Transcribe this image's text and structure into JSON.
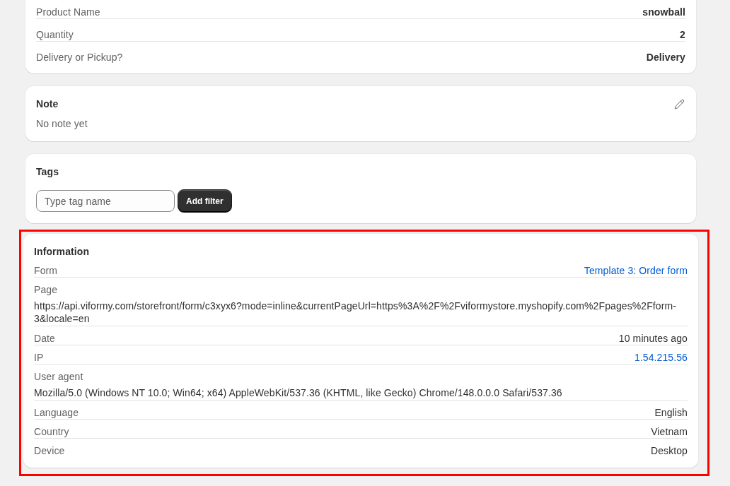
{
  "order_details": {
    "rows": [
      {
        "label": "Product Name",
        "value": "snowball"
      },
      {
        "label": "Quantity",
        "value": "2"
      },
      {
        "label": "Delivery or Pickup?",
        "value": "Delivery"
      }
    ]
  },
  "note": {
    "title": "Note",
    "text": "No note yet"
  },
  "tags": {
    "title": "Tags",
    "input": {
      "placeholder": "Type tag name"
    },
    "button": "Add filter"
  },
  "information": {
    "title": "Information",
    "highlighted": true,
    "rows": [
      {
        "kind": "inline",
        "label": "Form",
        "value": "Template 3: Order form",
        "link": true
      },
      {
        "kind": "stacked",
        "label": "Page",
        "value": "https://api.viformy.com/storefront/form/c3xyx6?mode=inline&currentPageUrl=https%3A%2F%2Fviformystore.myshopify.com%2Fpages%2Fform-3&locale=en",
        "link": false
      },
      {
        "kind": "inline",
        "label": "Date",
        "value": "10 minutes ago",
        "link": false
      },
      {
        "kind": "inline",
        "label": "IP",
        "value": "1.54.215.56",
        "link": true
      },
      {
        "kind": "stacked",
        "label": "User agent",
        "value": "Mozilla/5.0 (Windows NT 10.0; Win64; x64) AppleWebKit/537.36 (KHTML, like Gecko) Chrome/148.0.0.0 Safari/537.36",
        "link": false
      },
      {
        "kind": "inline",
        "label": "Language",
        "value": "English",
        "link": false
      },
      {
        "kind": "inline",
        "label": "Country",
        "value": "Vietnam",
        "link": false
      },
      {
        "kind": "inline",
        "label": "Device",
        "value": "Desktop",
        "link": false
      }
    ]
  }
}
